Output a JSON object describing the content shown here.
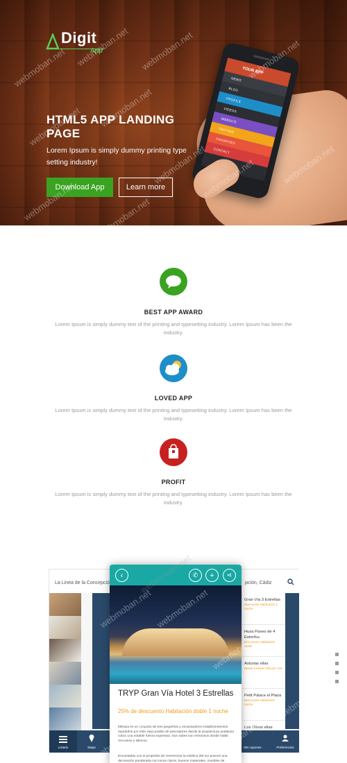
{
  "hero": {
    "logo_main": "Digit",
    "logo_sub": "App",
    "title": "HTML5 APP LANDING PAGE",
    "subtitle": "Lorem Ipsum is simply dummy printing type setting industry!",
    "download_label": "Download App",
    "learn_label": "Learn more",
    "phone_app_title": "YOUR APP",
    "phone_menu": [
      {
        "label": "NEWS",
        "color": "#3a3d44"
      },
      {
        "label": "BLOG",
        "color": "#2f3237"
      },
      {
        "label": "PROFILE",
        "color": "#1e8ec9"
      },
      {
        "label": "VIDEOS",
        "color": "#2c2e33"
      },
      {
        "label": "WEBSITE",
        "color": "#7a4fc2"
      },
      {
        "label": "TWITTER",
        "color": "#f2a51b"
      },
      {
        "label": "FAVORITES",
        "color": "#e8553a"
      },
      {
        "label": "CONTACT",
        "color": "#d63c3c"
      }
    ]
  },
  "features": [
    {
      "title": "BEST APP AWARD",
      "text": "Lorem Ipsum is simply dummy text of the printing and typesetting industry. Lorem Ipsum has been the industry.",
      "icon": "chat-bubble-icon",
      "color": "#3aa321"
    },
    {
      "title": "LOVED APP",
      "text": "Lorem Ipsum is simply dummy text of the printing and typesetting industry. Lorem Ipsum has been the industry.",
      "icon": "weather-cloud-icon",
      "color": "#1e8ec9"
    },
    {
      "title": "PROFIT",
      "text": "Lorem Ipsum is simply dummy text of the printing and typesetting industry. Lorem Ipsum has been the industry.",
      "icon": "shopping-bag-icon",
      "color": "#c8201e"
    }
  ],
  "mockup": {
    "tablet_left_title": "La Linea de la Concepción",
    "tablet_right_title": "pción, Cádiz",
    "list": [
      {
        "name": "Gran Vía 3 Estrellas",
        "promo": "descuento Habitación 1 noche"
      },
      {
        "name": "Husa Paseo de 4 Estrellas",
        "promo": "descuento Habitación doble"
      },
      {
        "name": "Asturias ellas",
        "promo": "desde Incluido ella por 21€"
      },
      {
        "name": "Petit Palace el Plaza",
        "promo": "descuento Habitación noche"
      },
      {
        "name": "Los Olivos ellas",
        "promo": ""
      }
    ],
    "footer": [
      "Listado",
      "Mapa",
      "Mis cupones",
      "Preferencias"
    ],
    "phone_title": "TRYP Gran Vía Hotel 3 Estrellas",
    "phone_promo": "25% de descuento Habitación doble 1 noche",
    "phone_body": "MiKasa es un conjunto de tres pequeños y encantadores establecimientos repartidos por este viejo pueblo de pescadores donde la arquitectura andaluza cobra una notable fuerza expresiva. Sus suites son remansos donde hallar descanso y silencio.",
    "phone_body2": "Encantadas con el propósito de reverenciar la estética del sur poseen una decoración ponderada con tonos claros, buenos materiales, muebles de maderas nobles y vistas inmejorables al"
  },
  "watermark": "webmoban.net",
  "colors": {
    "green": "#3aa321",
    "teal": "#19a8a3",
    "navy": "#2b4a6b",
    "orange": "#f29a1b"
  }
}
